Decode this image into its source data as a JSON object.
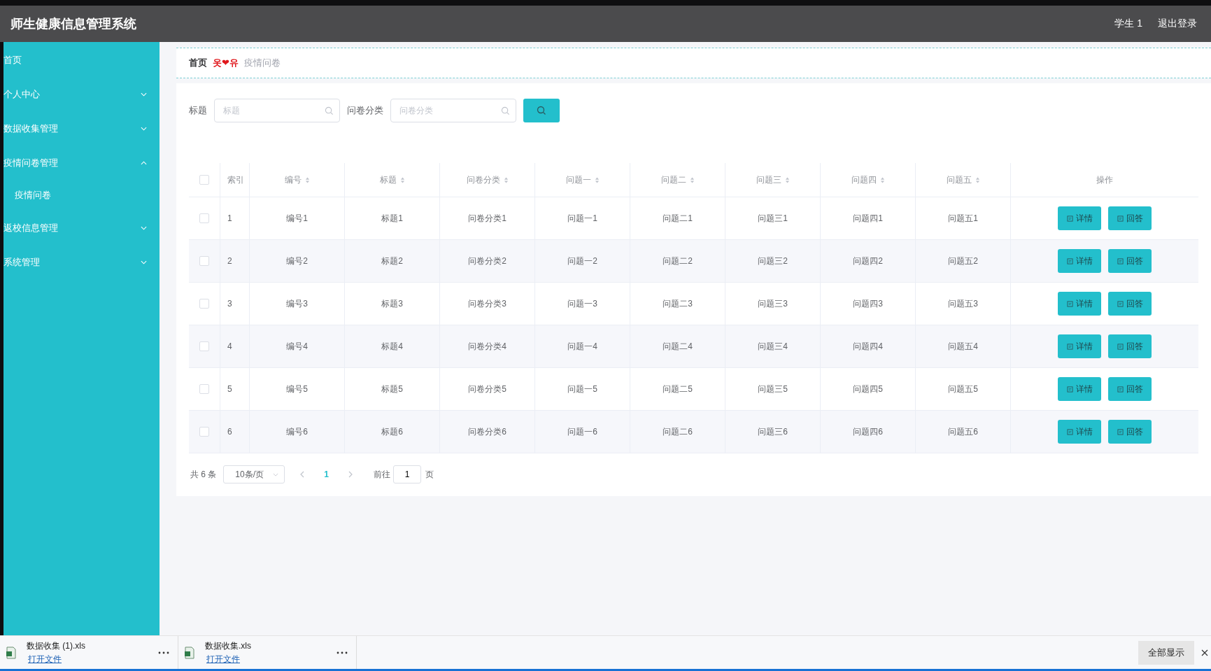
{
  "header": {
    "title": "师生健康信息管理系统",
    "user": "学生 1",
    "logout": "退出登录"
  },
  "sidebar": {
    "items": [
      {
        "label": "首页",
        "kind": "link"
      },
      {
        "label": "个人中心",
        "kind": "group",
        "expanded": false
      },
      {
        "label": "数据收集管理",
        "kind": "group",
        "expanded": false
      },
      {
        "label": "疫情问卷管理",
        "kind": "group",
        "expanded": true,
        "children": [
          {
            "label": "疫情问卷"
          }
        ]
      },
      {
        "label": "返校信息管理",
        "kind": "group",
        "expanded": false
      },
      {
        "label": "系统管理",
        "kind": "group",
        "expanded": false
      }
    ]
  },
  "breadcrumb": [
    {
      "text": "首页",
      "kind": "link"
    },
    {
      "text": "옷❤유",
      "kind": "separator"
    },
    {
      "text": "疫情问卷",
      "kind": "current"
    }
  ],
  "search": {
    "fields": [
      {
        "label": "标题",
        "placeholder": "标题"
      },
      {
        "label": "问卷分类",
        "placeholder": "问卷分类"
      }
    ]
  },
  "table": {
    "all_checked": false,
    "columns": [
      {
        "label": "索引",
        "sortable": false
      },
      {
        "label": "编号",
        "sortable": true
      },
      {
        "label": "标题",
        "sortable": true
      },
      {
        "label": "问卷分类",
        "sortable": true
      },
      {
        "label": "问题一",
        "sortable": true
      },
      {
        "label": "问题二",
        "sortable": true
      },
      {
        "label": "问题三",
        "sortable": true
      },
      {
        "label": "问题四",
        "sortable": true
      },
      {
        "label": "问题五",
        "sortable": true
      },
      {
        "label": "操作",
        "sortable": false
      }
    ],
    "rows": [
      {
        "checked": false,
        "cells": [
          "1",
          "编号1",
          "标题1",
          "问卷分类1",
          "问题一1",
          "问题二1",
          "问题三1",
          "问题四1",
          "问题五1"
        ],
        "actions": [
          "详情",
          "回答"
        ]
      },
      {
        "checked": false,
        "cells": [
          "2",
          "编号2",
          "标题2",
          "问卷分类2",
          "问题一2",
          "问题二2",
          "问题三2",
          "问题四2",
          "问题五2"
        ],
        "actions": [
          "详情",
          "回答"
        ]
      },
      {
        "checked": false,
        "cells": [
          "3",
          "编号3",
          "标题3",
          "问卷分类3",
          "问题一3",
          "问题二3",
          "问题三3",
          "问题四3",
          "问题五3"
        ],
        "actions": [
          "详情",
          "回答"
        ]
      },
      {
        "checked": false,
        "cells": [
          "4",
          "编号4",
          "标题4",
          "问卷分类4",
          "问题一4",
          "问题二4",
          "问题三4",
          "问题四4",
          "问题五4"
        ],
        "actions": [
          "详情",
          "回答"
        ]
      },
      {
        "checked": false,
        "cells": [
          "5",
          "编号5",
          "标题5",
          "问卷分类5",
          "问题一5",
          "问题二5",
          "问题三5",
          "问题四5",
          "问题五5"
        ],
        "actions": [
          "详情",
          "回答"
        ]
      },
      {
        "checked": false,
        "cells": [
          "6",
          "编号6",
          "标题6",
          "问卷分类6",
          "问题一6",
          "问题二6",
          "问题三6",
          "问题四6",
          "问题五6"
        ],
        "actions": [
          "详情",
          "回答"
        ]
      }
    ]
  },
  "pagination": {
    "total": "共 6 条",
    "page_size": "10条/页",
    "pages": [
      {
        "label": "1",
        "selected": true
      }
    ],
    "goto_label": "前往",
    "goto_value": "1",
    "page_suffix": "页"
  },
  "downloads": {
    "files": [
      {
        "name": "数据收集 (1).xls",
        "action": "打开文件"
      },
      {
        "name": "数据收集.xls",
        "action": "打开文件"
      }
    ],
    "show_all": "全部显示"
  }
}
